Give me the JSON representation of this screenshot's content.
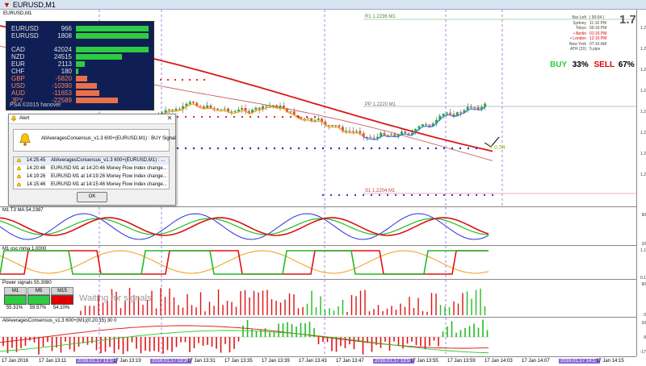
{
  "window": {
    "title": "EURUSD,M1"
  },
  "chart_header": {
    "symbol_tag": "EURUSD,M1"
  },
  "psa_panel": {
    "rows": [
      {
        "currency": "EURUSD",
        "value": "966",
        "bar_fraction": 0.95,
        "color": "#2ecc40"
      },
      {
        "currency": "EURUSD",
        "value": "1808",
        "bar_fraction": 0.95,
        "color": "#2ecc40"
      },
      {
        "currency": "CAD",
        "value": "42024",
        "bar_fraction": 0.95,
        "color": "#2ecc40"
      },
      {
        "currency": "NZD",
        "value": "24515",
        "bar_fraction": 0.6,
        "color": "#2ecc40"
      },
      {
        "currency": "EUR",
        "value": "2113",
        "bar_fraction": 0.12,
        "color": "#2ecc40"
      },
      {
        "currency": "CHF",
        "value": "180",
        "bar_fraction": 0.03,
        "color": "#2ecc40"
      },
      {
        "currency": "GBP",
        "value": "-5820",
        "bar_fraction": 0.15,
        "color": "#e8704a"
      },
      {
        "currency": "USD",
        "value": "-10390",
        "bar_fraction": 0.27,
        "color": "#e8704a"
      },
      {
        "currency": "AUD",
        "value": "-11653",
        "bar_fraction": 0.3,
        "color": "#e8704a"
      },
      {
        "currency": "JPY",
        "value": "-22589",
        "bar_fraction": 0.55,
        "color": "#e8704a"
      }
    ],
    "footer": "PSA ©2015 hanover"
  },
  "alert": {
    "title": "Alert",
    "message": "AllAveragesConsensus_v1.3 600+(EURUSD,M1) : BUY Signal",
    "items": [
      {
        "time": "14:25:45",
        "text": "AllAveragesConsensus_v1.3 600+(EURUSD,M1) : ..."
      },
      {
        "time": "14:20:46",
        "text": "EURUSD M1 at 14:20:46 Money Flow Index change..."
      },
      {
        "time": "14:19:26",
        "text": "EURUSD M1 at 14:19:26 Money Flow Index change..."
      },
      {
        "time": "14:15:46",
        "text": "EURUSD M1 at 14:15:46 Money Flow Index change..."
      }
    ],
    "ok_label": "OK"
  },
  "clock": {
    "big": "1.7",
    "lines": [
      {
        "city": "Bar Left",
        "time": "| 00:04 |"
      },
      {
        "city": "Sydney",
        "time": "11:16 PM"
      },
      {
        "city": "Tokyo",
        "time": "09:16 PM"
      },
      {
        "city": "• Berlin",
        "time": "01:16 PM"
      },
      {
        "city": "• London",
        "time": "12:16 PM"
      },
      {
        "city": "New York",
        "time": "07:16 AM"
      },
      {
        "city": "ATR (20)",
        "time": "5 pips"
      }
    ]
  },
  "signal": {
    "buy_label": "BUY",
    "buy_pct": "33%",
    "sell_label": "SELL",
    "sell_pct": "67%"
  },
  "levels": {
    "r1": "R1 1.2236 M1",
    "pp": "PP 1.2220 M1",
    "s1": "S1 1.2204 M1",
    "last_price_tag": "< 0.54"
  },
  "panes": {
    "t3": "M1 T3 MA 54.2387",
    "osc": "M1 osc mma 1.0000",
    "power": "Power signals 55.3080",
    "consensus": "AllAveragesConsensus_v1.3 600+(M1)(0.20,15) 30 0"
  },
  "power_signals": {
    "headers": [
      "M1",
      "M5",
      "M15"
    ],
    "colors": [
      "#2ecc40",
      "#2ecc40",
      "#e00000"
    ],
    "percents": [
      "55.31%",
      "59.57%",
      "54.10%"
    ],
    "waiting": "Waiting for signals"
  },
  "price_scale": [
    "1.2",
    "1.2",
    "1.2",
    "1.2",
    "1.2",
    "1.2",
    "1.2",
    "1.2"
  ],
  "pane_scales": {
    "t3": [
      "90",
      "10"
    ],
    "osc": [
      "1.1",
      "0.1"
    ],
    "power": [
      "90",
      "0"
    ],
    "consensus": [
      "33",
      "8",
      "-17"
    ]
  },
  "time_axis": [
    {
      "label": "17 Jan 2016",
      "hl": false
    },
    {
      "label": "17 Jan 13:11",
      "hl": false
    },
    {
      "label": "2016.01.17 13:18",
      "hl": true
    },
    {
      "label": "17 Jan 13:19",
      "hl": false
    },
    {
      "label": "2016.01.17 13:26",
      "hl": true
    },
    {
      "label": "17 Jan 13:31",
      "hl": false
    },
    {
      "label": "17 Jan 13:35",
      "hl": false
    },
    {
      "label": "17 Jan 13:39",
      "hl": false
    },
    {
      "label": "17 Jan 13:43",
      "hl": false
    },
    {
      "label": "17 Jan 13:47",
      "hl": false
    },
    {
      "label": "2016.01.17 13:53",
      "hl": true
    },
    {
      "label": "17 Jan 13:55",
      "hl": false
    },
    {
      "label": "17 Jan 13:59",
      "hl": false
    },
    {
      "label": "17 Jan 14:03",
      "hl": false
    },
    {
      "label": "17 Jan 14:07",
      "hl": false
    },
    {
      "label": "2016.01.17 14:12",
      "hl": true
    },
    {
      "label": "17 Jan 14:15",
      "hl": false
    }
  ]
}
